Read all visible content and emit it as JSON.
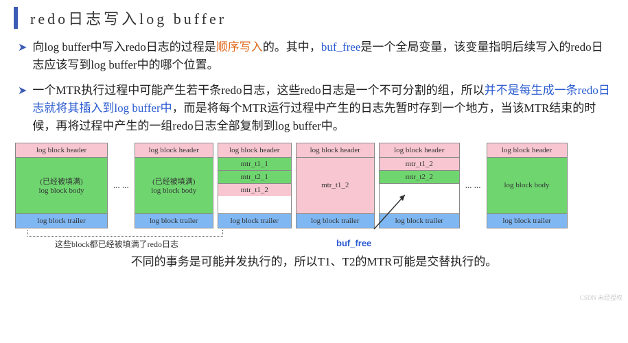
{
  "title": "redo日志写入log buffer",
  "bullet1": {
    "p1": "向log buffer中写入redo日志的过程是",
    "orange1": "顺序写入",
    "p2": "的。其中，",
    "blue1": "buf_free",
    "p3": "是一个全局变量，该变量指明后续写入的redo日志应该写到log buffer中的哪个位置。"
  },
  "bullet2": {
    "p1": "一个MTR执行过程中可能产生若干条redo日志，这些redo日志是一个不可分割的组，所以",
    "blue1": "并不是每生成一条redo日志就将其插入到log buffer中",
    "p2": "，而是将每个MTR运行过程中产生的日志先暂时存到一个地方，当该MTR结束的时候，再将过程中产生的一组redo日志全部复制到log buffer中。"
  },
  "diagram": {
    "hdr": "log block header",
    "trailer": "log block trailer",
    "body_label": "log block body",
    "filled1": "(已经被填满)",
    "filled2": "(已经被填满)",
    "mtr_t1_1": "mtr_t1_1",
    "mtr_t2_1": "mtr_t2_1",
    "mtr_t1_2": "mtr_t1_2",
    "mtr_t1_2b": "mtr_t1_2",
    "mtr_t1_2c": "mtr_t1_2",
    "mtr_t2_2": "mtr_t2_2",
    "dots": "... ...",
    "dots2": "... ..."
  },
  "brace_note": "这些block都已经被填满了redo日志",
  "buf_free": "buf_free",
  "bottom": "不同的事务是可能并发执行的，所以T1、T2的MTR可能是交替执行的。",
  "watermark": "CSDN 未经授权"
}
